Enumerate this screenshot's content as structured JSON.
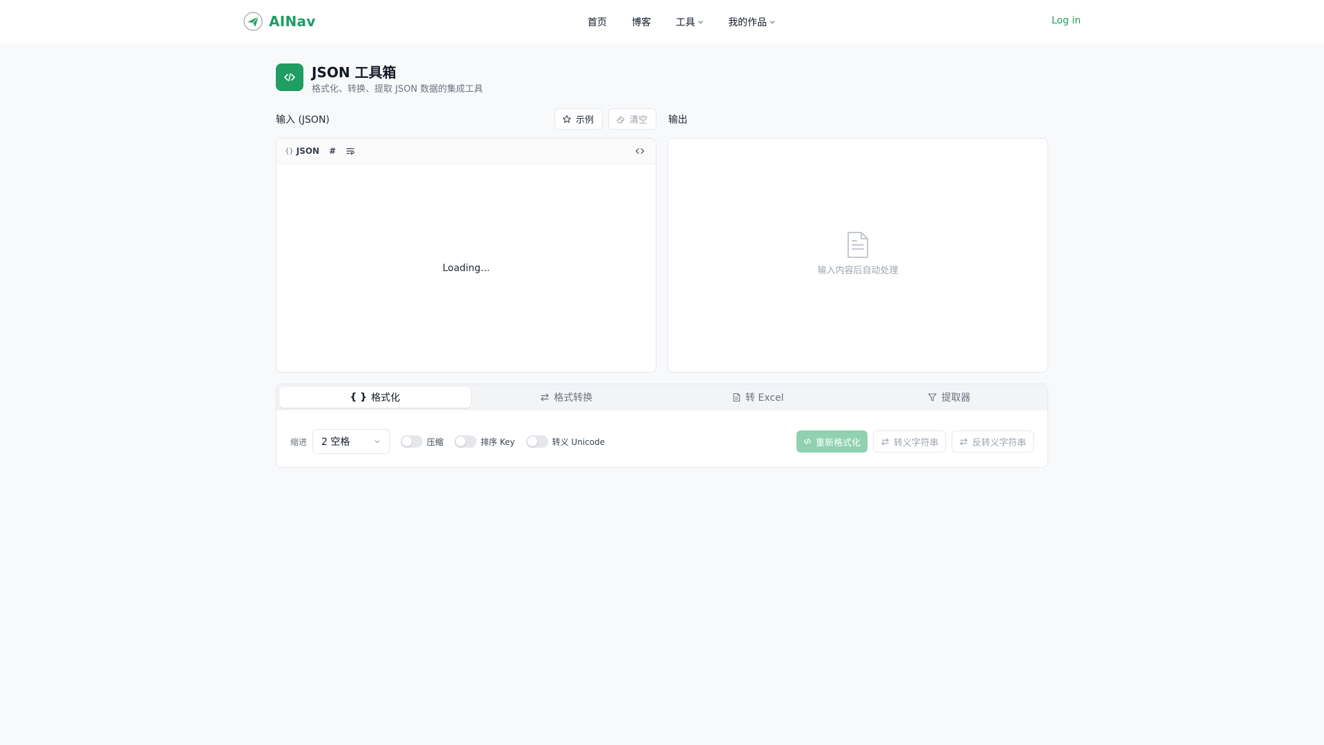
{
  "header": {
    "brand": "AINav",
    "nav": [
      {
        "label": "首页",
        "has_menu": false
      },
      {
        "label": "博客",
        "has_menu": false
      },
      {
        "label": "工具",
        "has_menu": true
      },
      {
        "label": "我的作品",
        "has_menu": true
      }
    ],
    "login": "Log in"
  },
  "page": {
    "title": "JSON 工具箱",
    "subtitle": "格式化、转换、提取 JSON 数据的集成工具"
  },
  "input": {
    "label": "输入 (JSON)",
    "example_btn": "示例",
    "clear_btn": "清空",
    "editor_tag": "JSON",
    "editor_tag_brace": "{}",
    "hash_btn": "#",
    "loading": "Loading..."
  },
  "output": {
    "label": "输出",
    "empty_text": "输入内容后自动处理"
  },
  "tabs": [
    {
      "label": "格式化",
      "icon": "braces-icon",
      "active": true
    },
    {
      "label": "格式转换",
      "icon": "swap-icon",
      "active": false
    },
    {
      "label": "转 Excel",
      "icon": "file-icon",
      "active": false
    },
    {
      "label": "提取器",
      "icon": "filter-icon",
      "active": false
    }
  ],
  "options": {
    "indent_label": "缩进",
    "indent_value": "2 空格",
    "toggles": [
      {
        "label": "压缩",
        "on": false
      },
      {
        "label": "排序 Key",
        "on": false
      },
      {
        "label": "转义 Unicode",
        "on": false
      }
    ],
    "reformat_btn": "重新格式化",
    "escape_btn": "转义字符串",
    "unescape_btn": "反转义字符串"
  },
  "colors": {
    "accent": "#1f9d63",
    "accent_light": "#8fd1b0"
  }
}
